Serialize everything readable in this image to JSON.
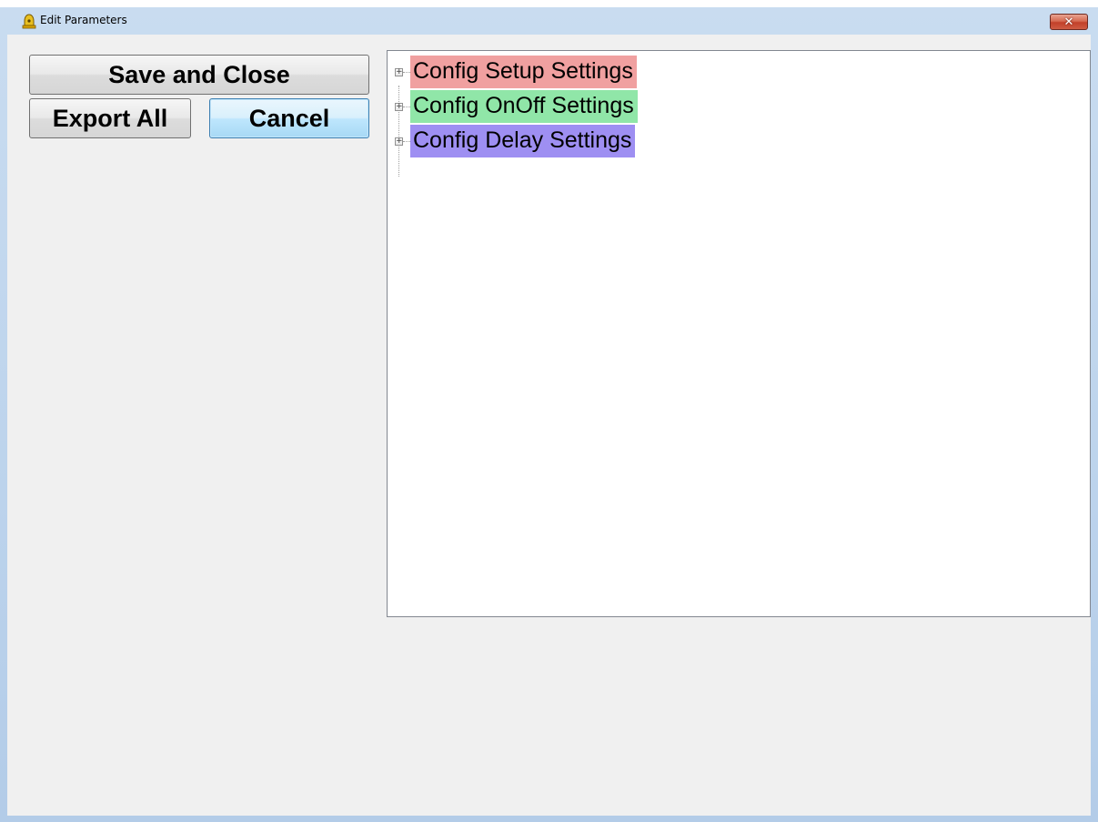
{
  "window": {
    "title": "Edit Parameters",
    "close_symbol": "✕"
  },
  "buttons": {
    "save_close": "Save and Close",
    "export_all": "Export All",
    "cancel": "Cancel"
  },
  "tree": {
    "expand_symbol": "+",
    "items": [
      {
        "label": "Config Setup Settings",
        "color": "#f0a0a0"
      },
      {
        "label": "Config OnOff Settings",
        "color": "#90e6a8"
      },
      {
        "label": "Config Delay Settings",
        "color": "#9e8ff2"
      }
    ]
  }
}
